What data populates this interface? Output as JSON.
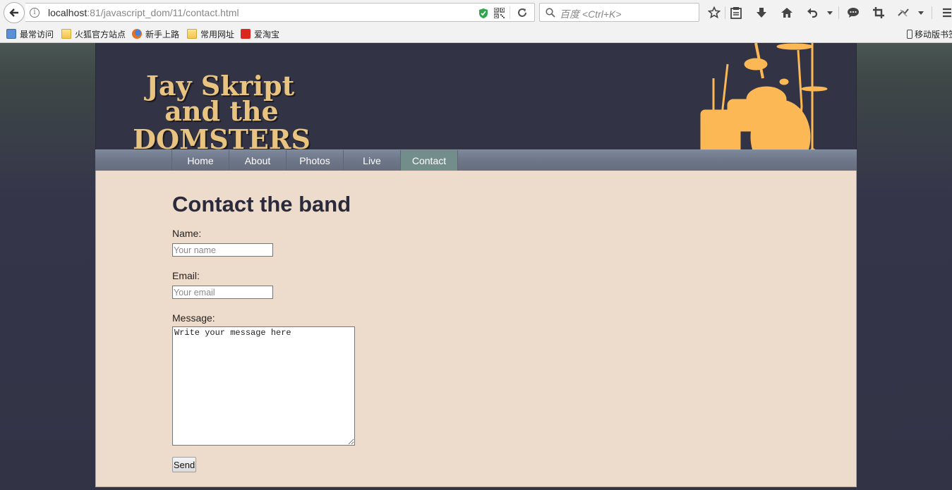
{
  "browser": {
    "url_host": "localhost",
    "url_rest": ":81/javascript_dom/11/contact.html",
    "search_placeholder": "百度 <Ctrl+K>",
    "bookmarks": [
      "最常访问",
      "火狐官方站点",
      "新手上路",
      "常用网址",
      "爱淘宝"
    ],
    "mobile_bookmarks": "移动版书签",
    "icons": [
      "back-arrow-icon",
      "info-icon",
      "shield-icon",
      "qr-code-icon",
      "reload-icon",
      "search-icon",
      "star-icon",
      "reader-list-icon",
      "download-icon",
      "home-icon",
      "undo-icon",
      "chat-icon",
      "crop-icon",
      "extension-icon",
      "menu-icon"
    ]
  },
  "site": {
    "logo_lines": [
      "Jay Skript",
      "and the",
      "DOMSTERS"
    ],
    "nav": [
      "Home",
      "About",
      "Photos",
      "Live",
      "Contact"
    ],
    "active_nav": "Contact",
    "accent_color": "#fbb854",
    "header_bg": "#333346",
    "content_bg": "#eddbcc"
  },
  "content": {
    "title": "Contact the band",
    "name_label": "Name:",
    "name_placeholder": "Your name",
    "email_label": "Email:",
    "email_placeholder": "Your email",
    "message_label": "Message:",
    "message_value": "Write your message here",
    "send_label": "Send"
  }
}
